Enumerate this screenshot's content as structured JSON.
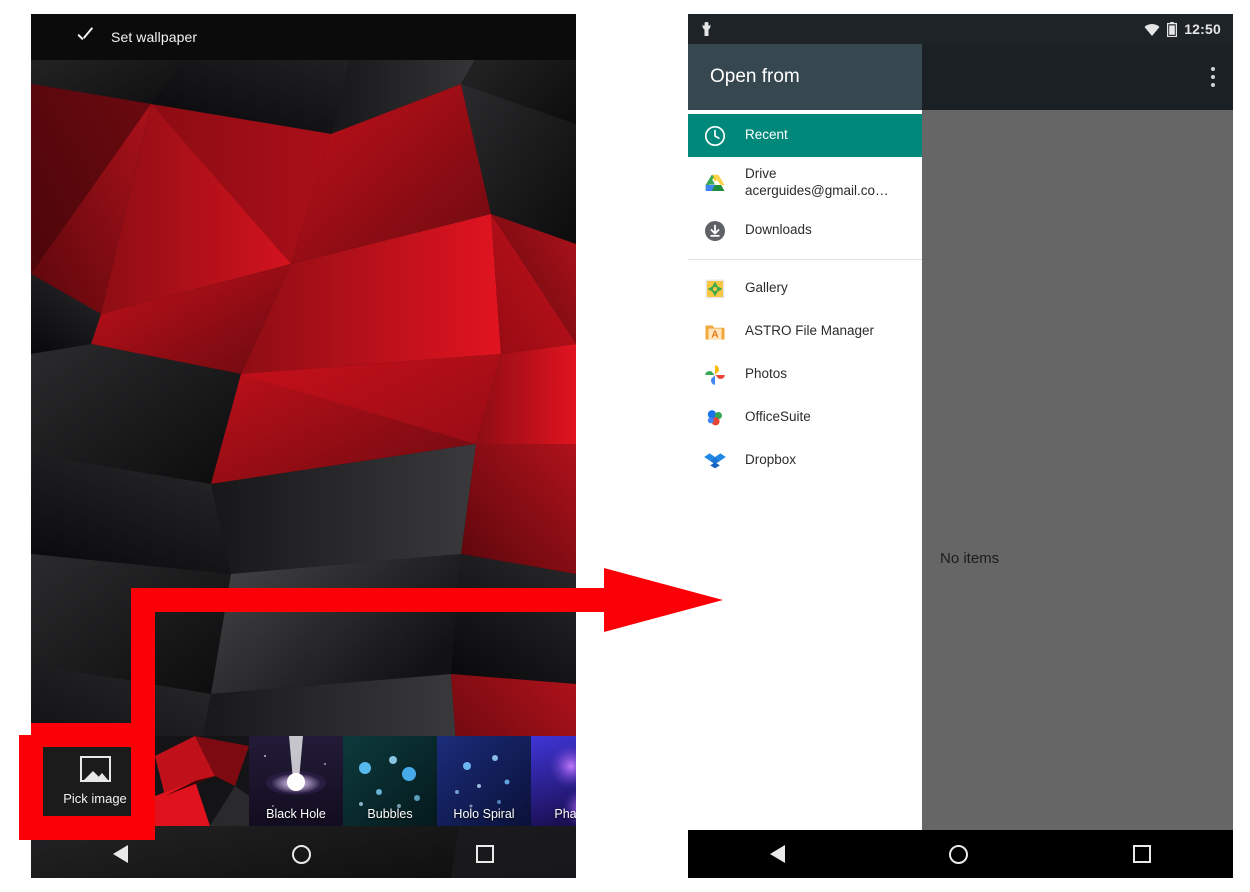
{
  "left_phone": {
    "actionbar": {
      "check_icon": "checkmark-icon",
      "title": "Set wallpaper"
    },
    "wallpaper_picker": {
      "pick_image": {
        "icon": "image-icon",
        "label": "Pick image"
      },
      "thumbnails": [
        {
          "label": "",
          "name": "current-wallpaper"
        },
        {
          "label": "Black Hole",
          "name": "black-hole"
        },
        {
          "label": "Bubbles",
          "name": "bubbles"
        },
        {
          "label": "Holo Spiral",
          "name": "holo-spiral"
        },
        {
          "label": "Phase B",
          "name": "phase-beam"
        }
      ]
    },
    "navbar": {
      "back": "back-icon",
      "home": "home-icon",
      "recents": "recents-icon"
    }
  },
  "annotation": {
    "color": "#fb0007",
    "shape": "callout-arrow-from-pick-image-to-open-from-dialog"
  },
  "right_phone": {
    "statusbar": {
      "usb_icon": "usb-debugging-icon",
      "wifi_icon": "wifi-icon",
      "battery_icon": "battery-icon",
      "time": "12:50"
    },
    "header": {
      "title": "Open from",
      "overflow": "overflow-menu-icon"
    },
    "sidebar": {
      "groups": [
        {
          "items": [
            {
              "label": "Recent",
              "sub": "",
              "icon": "clock-icon",
              "selected": true
            },
            {
              "label": "Drive",
              "sub": "acerguides@gmail.co…",
              "icon": "google-drive-icon",
              "selected": false
            },
            {
              "label": "Downloads",
              "sub": "",
              "icon": "download-icon",
              "selected": false
            }
          ]
        },
        {
          "items": [
            {
              "label": "Gallery",
              "sub": "",
              "icon": "gallery-icon",
              "selected": false
            },
            {
              "label": "ASTRO File Manager",
              "sub": "",
              "icon": "astro-folder-icon",
              "selected": false
            },
            {
              "label": "Photos",
              "sub": "",
              "icon": "google-photos-icon",
              "selected": false
            },
            {
              "label": "OfficeSuite",
              "sub": "",
              "icon": "officesuite-icon",
              "selected": false
            },
            {
              "label": "Dropbox",
              "sub": "",
              "icon": "dropbox-icon",
              "selected": false
            }
          ]
        }
      ]
    },
    "content": {
      "empty_message": "No items"
    },
    "navbar": {
      "back": "back-icon",
      "home": "home-icon",
      "recents": "recents-icon"
    }
  },
  "colors": {
    "accent_teal": "#00897b",
    "header_gray": "#37474f",
    "header_dark": "#1a2024",
    "content_gray": "#666666",
    "annotation_red": "#fb0007"
  }
}
